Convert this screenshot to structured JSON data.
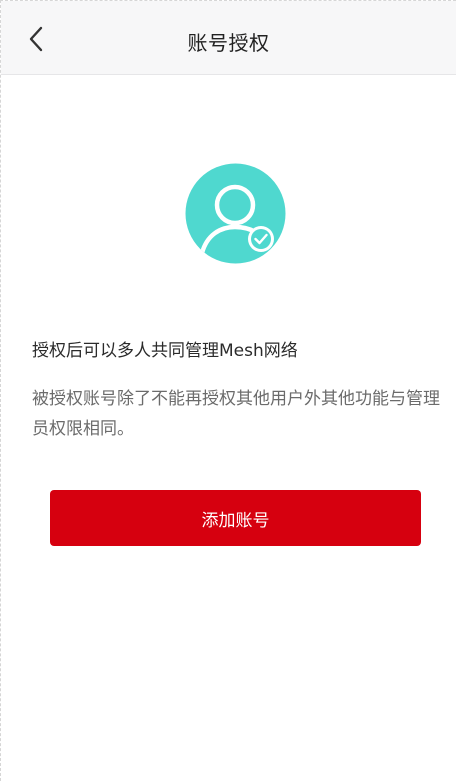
{
  "header": {
    "title": "账号授权",
    "back_icon": "chevron-left-icon"
  },
  "avatar": {
    "icon": "user-check-avatar-icon",
    "color": "#4fd8cf"
  },
  "main": {
    "headline": "授权后可以多人共同管理Mesh网络",
    "description": "被授权账号除了不能再授权其他用户外其他功能与管理员权限相同。",
    "add_button_label": "添加账号"
  },
  "colors": {
    "primary_button": "#d6000f",
    "nav_background": "#f7f7f8"
  }
}
